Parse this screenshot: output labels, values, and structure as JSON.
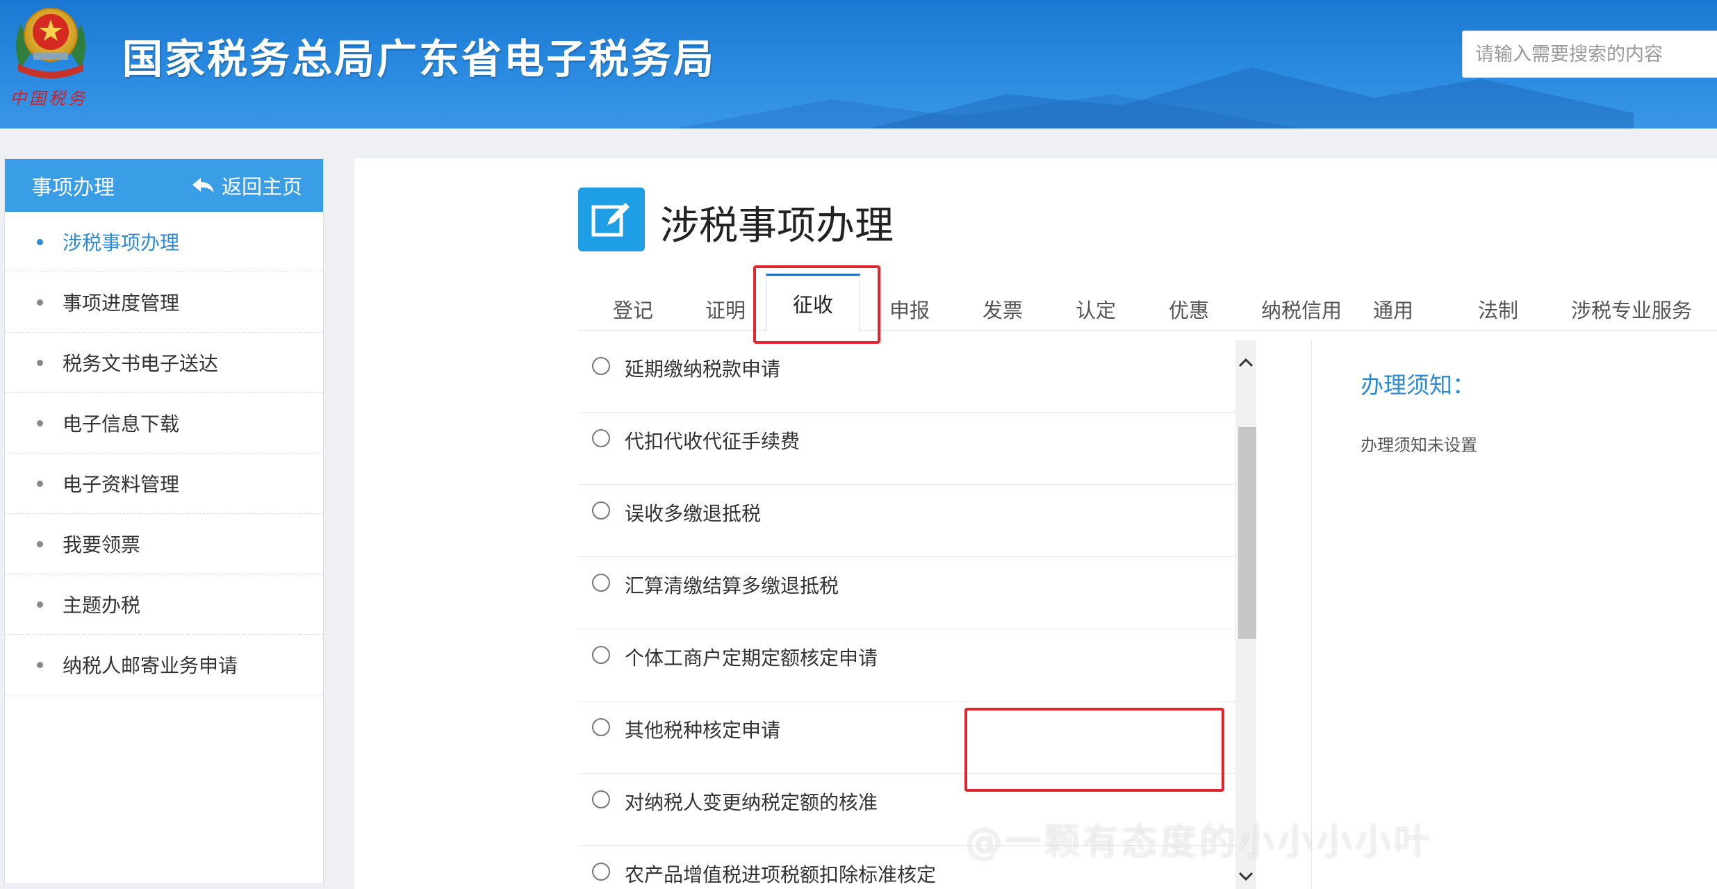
{
  "header": {
    "site_title": "国家税务总局广东省电子税务局",
    "brand_sub": "中国税务",
    "search_placeholder": "请输入需要搜索的内容",
    "gradient_color": "#1b78d2"
  },
  "sidebar": {
    "title": "事项办理",
    "back_label": "返回主页",
    "items": [
      {
        "label": "涉税事项办理",
        "active": true
      },
      {
        "label": "事项进度管理"
      },
      {
        "label": "税务文书电子送达"
      },
      {
        "label": "电子信息下载"
      },
      {
        "label": "电子资料管理"
      },
      {
        "label": "我要领票"
      },
      {
        "label": "主题办税"
      },
      {
        "label": "纳税人邮寄业务申请"
      }
    ]
  },
  "main": {
    "page_title": "涉税事项办理",
    "tabs": [
      {
        "label": "登记"
      },
      {
        "label": "证明"
      },
      {
        "label": "征收",
        "active": true
      },
      {
        "label": "申报"
      },
      {
        "label": "发票"
      },
      {
        "label": "认定"
      },
      {
        "label": "优惠"
      },
      {
        "label": "纳税信用"
      },
      {
        "label": "通用"
      },
      {
        "label": "法制"
      },
      {
        "label": "涉税专业服务"
      }
    ],
    "items": [
      {
        "label": "延期缴纳税款申请"
      },
      {
        "label": "代扣代收代征手续费"
      },
      {
        "label": "误收多缴退抵税"
      },
      {
        "label": "汇算清缴结算多缴退抵税",
        "highlighted": true
      },
      {
        "label": "个体工商户定期定额核定申请"
      },
      {
        "label": "其他税种核定申请"
      },
      {
        "label": "对纳税人变更纳税定额的核准"
      },
      {
        "label": "农产品增值税进项税额扣除标准核定"
      }
    ],
    "notice_title": "办理须知：",
    "notice_text": "办理须知未设置"
  },
  "watermark": "@一颗有态度的小小小小叶",
  "colors": {
    "accent": "#2d8bd6",
    "highlight": "#e3262d",
    "sidebar_head": "#3a9ee7"
  }
}
